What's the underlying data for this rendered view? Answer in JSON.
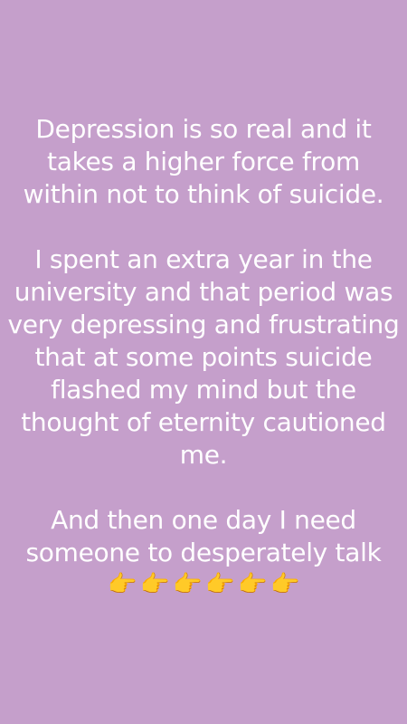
{
  "story": {
    "paragraphs": [
      "Depression is so real and it takes a higher force from within not to think of suicide.",
      "I spent an extra year in the university and that period was very depressing and frustrating that at some points suicide flashed my mind but the thought of eternity cautioned me.",
      "And then one day I need someone to desperately talk"
    ],
    "emoji": [
      "👉",
      "👉",
      "👉",
      "👉",
      "👉",
      "👉"
    ]
  },
  "colors": {
    "background": "#c59fcb",
    "text": "#ffffff"
  }
}
